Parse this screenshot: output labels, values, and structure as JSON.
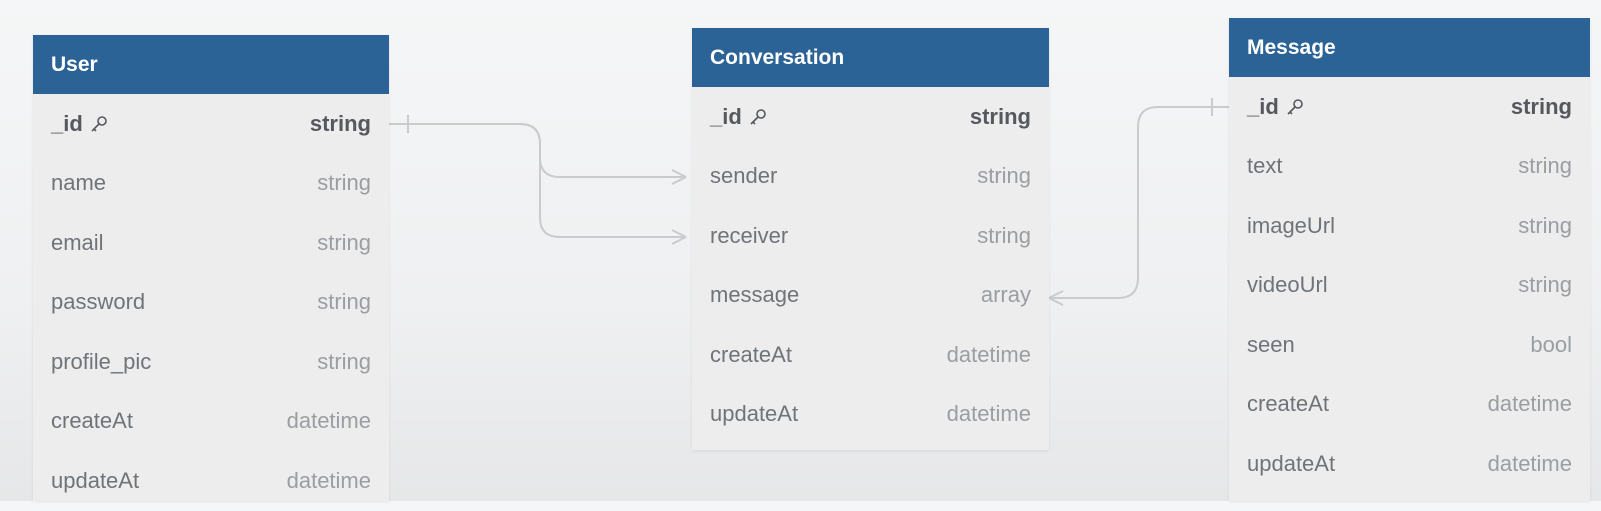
{
  "tables": {
    "user": {
      "title": "User",
      "fields": [
        {
          "name": "_id",
          "type": "string",
          "pk": true
        },
        {
          "name": "name",
          "type": "string"
        },
        {
          "name": "email",
          "type": "string"
        },
        {
          "name": "password",
          "type": "string"
        },
        {
          "name": "profile_pic",
          "type": "string"
        },
        {
          "name": "createAt",
          "type": "datetime"
        },
        {
          "name": "updateAt",
          "type": "datetime"
        }
      ]
    },
    "conversation": {
      "title": "Conversation",
      "fields": [
        {
          "name": "_id",
          "type": "string",
          "pk": true
        },
        {
          "name": "sender",
          "type": "string"
        },
        {
          "name": "receiver",
          "type": "string"
        },
        {
          "name": "message",
          "type": "array"
        },
        {
          "name": "createAt",
          "type": "datetime"
        },
        {
          "name": "updateAt",
          "type": "datetime"
        }
      ]
    },
    "message": {
      "title": "Message",
      "fields": [
        {
          "name": "_id",
          "type": "string",
          "pk": true
        },
        {
          "name": "text",
          "type": "string"
        },
        {
          "name": "imageUrl",
          "type": "string"
        },
        {
          "name": "videoUrl",
          "type": "string"
        },
        {
          "name": "seen",
          "type": "bool"
        },
        {
          "name": "createAt",
          "type": "datetime"
        },
        {
          "name": "updateAt",
          "type": "datetime"
        }
      ]
    }
  },
  "relations": [
    {
      "from": "user._id",
      "to": "conversation.sender",
      "type": "one-to-many"
    },
    {
      "from": "user._id",
      "to": "conversation.receiver",
      "type": "one-to-many"
    },
    {
      "from": "conversation.message",
      "to": "message._id",
      "type": "many-to-one"
    }
  ],
  "colors": {
    "header": "#2c6396",
    "header_text": "#ffffff",
    "body": "#ededee",
    "connector": "#c9cbcd"
  },
  "icons": {
    "primary_key": "key-icon"
  }
}
